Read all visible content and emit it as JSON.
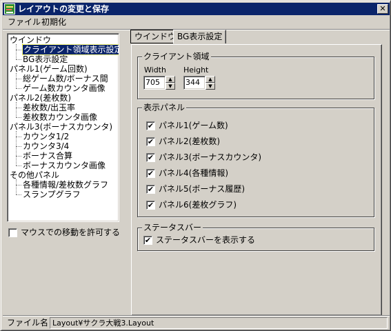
{
  "window": {
    "title": "レイアウトの変更と保存",
    "close_glyph": "✕"
  },
  "menu": {
    "items": [
      "ファイル",
      "初期化"
    ]
  },
  "tree": {
    "items": [
      {
        "label": "ウインドウ",
        "level": 0
      },
      {
        "label": "クライアント領域表示設定",
        "level": 1,
        "selected": true
      },
      {
        "label": "BG表示設定",
        "level": 1
      },
      {
        "label": "パネル1(ゲーム回数)",
        "level": 0
      },
      {
        "label": "総ゲーム数/ボーナス間",
        "level": 1
      },
      {
        "label": "ゲーム数カウンタ画像",
        "level": 1
      },
      {
        "label": "パネル2(差枚数)",
        "level": 0
      },
      {
        "label": "差枚数/出玉率",
        "level": 1
      },
      {
        "label": "差枚数カウンタ画像",
        "level": 1
      },
      {
        "label": "パネル3(ボーナスカウンタ)",
        "level": 0
      },
      {
        "label": "カウンタ1/2",
        "level": 1
      },
      {
        "label": "カウンタ3/4",
        "level": 1
      },
      {
        "label": "ボーナス合算",
        "level": 1
      },
      {
        "label": "ボーナスカウンタ画像",
        "level": 1
      },
      {
        "label": "その他パネル",
        "level": 0
      },
      {
        "label": "各種情報/差枚数グラフ",
        "level": 1
      },
      {
        "label": "スランプグラフ",
        "level": 1
      }
    ]
  },
  "mouse_move": {
    "label": "マウスでの移動を許可する",
    "checked": false
  },
  "tabs": [
    "ウインドウ",
    "BG表示設定"
  ],
  "client_area": {
    "title": "クライアント領域",
    "width_label": "Width",
    "height_label": "Height",
    "width_value": "705",
    "height_value": "344"
  },
  "display_panels": {
    "title": "表示パネル",
    "items": [
      {
        "label": "パネル1(ゲーム数)",
        "checked": true
      },
      {
        "label": "パネル2(差枚数)",
        "checked": true
      },
      {
        "label": "パネル3(ボーナスカウンタ)",
        "checked": true
      },
      {
        "label": "パネル4(各種情報)",
        "checked": true
      },
      {
        "label": "パネル5(ボーナス履歴)",
        "checked": true
      },
      {
        "label": "パネル6(差枚グラフ)",
        "checked": true
      }
    ]
  },
  "status_bar_group": {
    "title": "ステータスバー",
    "label": "ステータスバーを表示する",
    "checked": true
  },
  "status": {
    "label": "ファイル名",
    "value": "Layout¥サクラ大戦3.Layout"
  },
  "check_glyph": "✔"
}
